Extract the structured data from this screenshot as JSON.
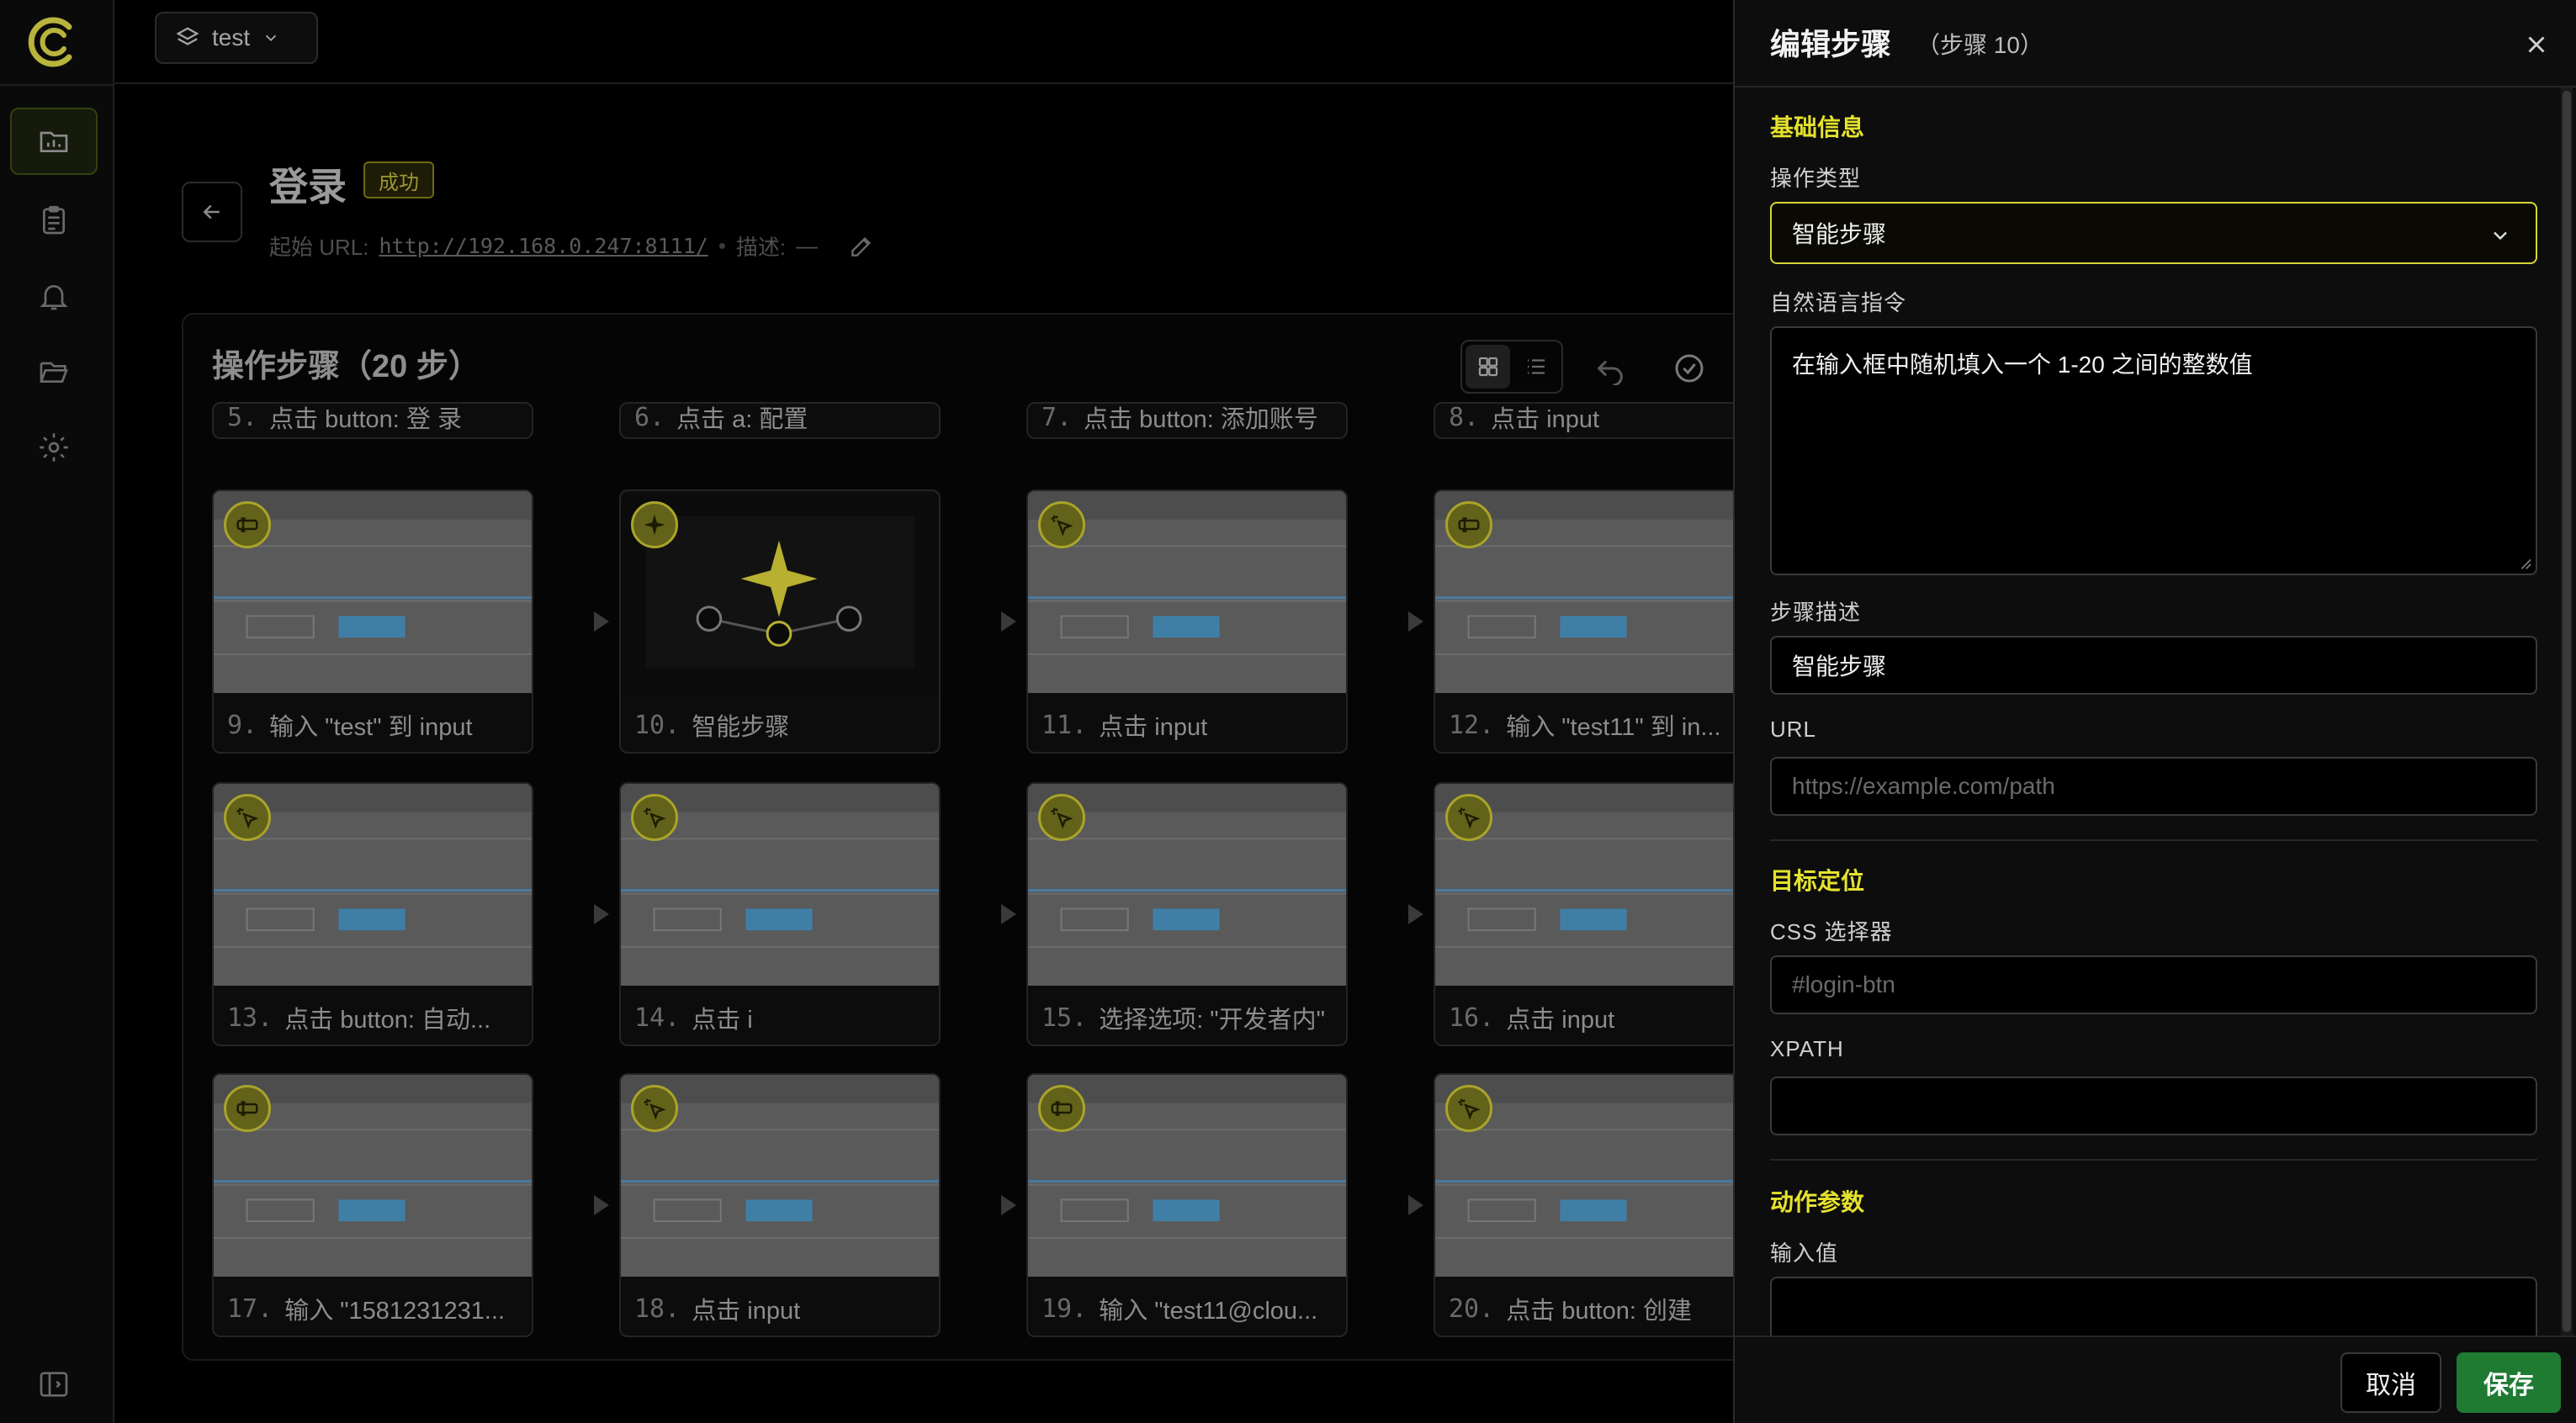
{
  "workspace": {
    "name": "test"
  },
  "nav": {
    "items": [
      {
        "icon": "folder-chart-icon",
        "active": true
      },
      {
        "icon": "clipboard-icon",
        "active": false
      },
      {
        "icon": "bell-icon",
        "active": false
      },
      {
        "icon": "folder-open-icon",
        "active": false
      },
      {
        "icon": "gear-icon",
        "active": false
      }
    ],
    "collapse_icon": "sidebar-toggle-icon"
  },
  "page": {
    "title": "登录",
    "status": "成功",
    "start_url_label": "起始 URL:",
    "start_url": "http://192.168.0.247:8111/",
    "separator": "•",
    "desc_label": "描述:",
    "desc_value": "—"
  },
  "steps_panel": {
    "title": "操作步骤（20 步）",
    "partial_row": [
      {
        "num": "5.",
        "text": "点击 button: 登 录"
      },
      {
        "num": "6.",
        "text": "点击 a: 配置"
      },
      {
        "num": "7.",
        "text": "点击 button: 添加账号"
      },
      {
        "num": "8.",
        "text": "点击 input"
      }
    ],
    "cards": [
      {
        "num": "9.",
        "text": "输入 \"test\" 到 input",
        "icon": "input-icon"
      },
      {
        "num": "10.",
        "text": "智能步骤",
        "icon": "sparkle-icon"
      },
      {
        "num": "11.",
        "text": "点击 input",
        "icon": "click-icon"
      },
      {
        "num": "12.",
        "text": "输入 \"test11\" 到 in...",
        "icon": "input-icon"
      },
      {
        "num": "13.",
        "text": "点击 button: 自动...",
        "icon": "click-icon"
      },
      {
        "num": "14.",
        "text": "点击 i",
        "icon": "click-icon"
      },
      {
        "num": "15.",
        "text": "选择选项: \"开发者内\"",
        "icon": "click-icon"
      },
      {
        "num": "16.",
        "text": "点击 input",
        "icon": "click-icon"
      },
      {
        "num": "17.",
        "text": "输入 \"1581231231...",
        "icon": "input-icon"
      },
      {
        "num": "18.",
        "text": "点击 input",
        "icon": "click-icon"
      },
      {
        "num": "19.",
        "text": "输入 \"test11@clou...",
        "icon": "input-icon"
      },
      {
        "num": "20.",
        "text": "点击 button: 创建",
        "icon": "click-icon"
      }
    ]
  },
  "drawer": {
    "title": "编辑步骤",
    "subtitle": "（步骤 10）",
    "sections": {
      "basic": "基础信息",
      "target": "目标定位",
      "action": "动作参数"
    },
    "fields": {
      "op_type_label": "操作类型",
      "op_type_value": "智能步骤",
      "nl_label": "自然语言指令",
      "nl_value": "在输入框中随机填入一个 1-20 之间的整数值",
      "desc_label": "步骤描述",
      "desc_value": "智能步骤",
      "url_label": "URL",
      "url_placeholder": "https://example.com/path",
      "css_label": "CSS 选择器",
      "css_placeholder": "#login-btn",
      "xpath_label": "XPATH",
      "xpath_value": "",
      "input_label": "输入值",
      "input_value": ""
    },
    "buttons": {
      "cancel": "取消",
      "save": "保存"
    }
  },
  "colors": {
    "accent": "#e5e22e",
    "success_badge": "#9d9632",
    "save_button": "#1f7a32"
  }
}
